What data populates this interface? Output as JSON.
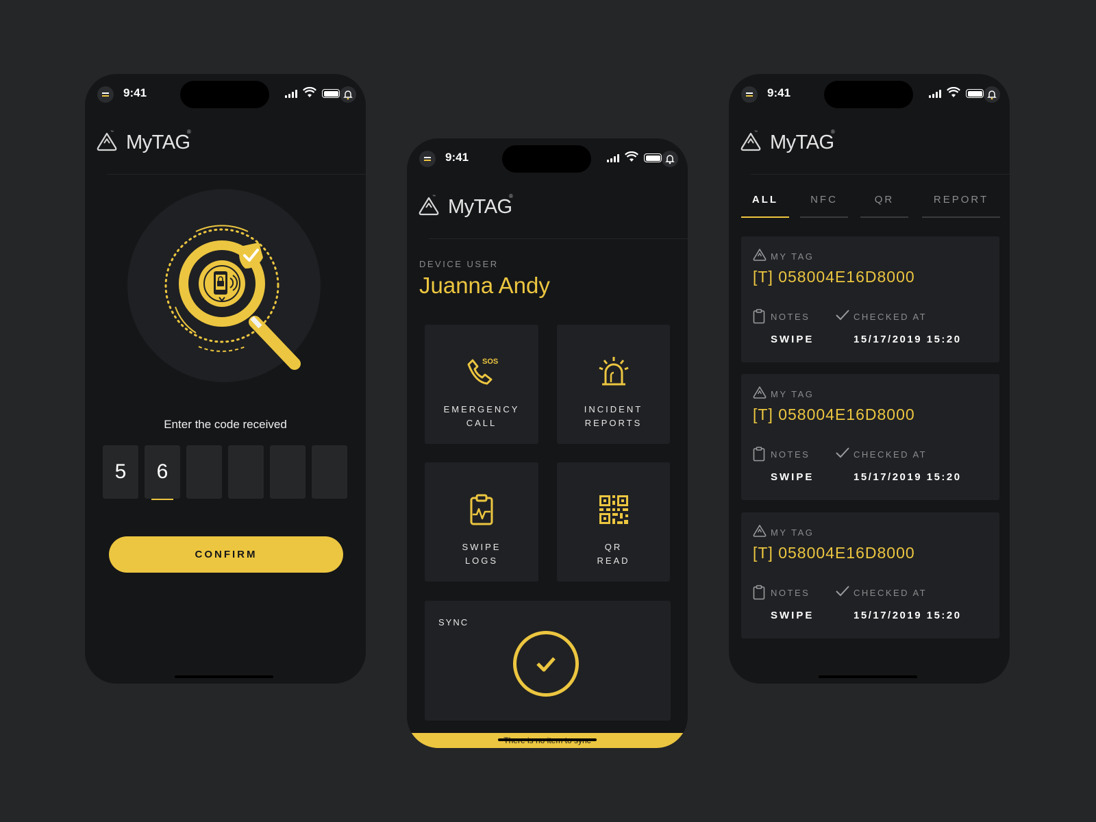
{
  "theme": {
    "background": "#252628",
    "phone": "#151618",
    "card": "#202124",
    "accent": "#ecc640"
  },
  "status": {
    "time": "9:41"
  },
  "brand": {
    "name": "MyTAG",
    "reg": "®",
    "tm": "™"
  },
  "verify": {
    "prompt": "Enter the code received",
    "code": [
      "5",
      "6",
      "",
      "",
      "",
      ""
    ],
    "active_index": 1,
    "confirm_label": "CONFIRM",
    "hero_icon": "magnifier-phone-lock-icon"
  },
  "home": {
    "device_label": "DEVICE USER",
    "device_name": "Juanna Andy",
    "tiles": [
      {
        "label": "EMERGENCY\nCALL",
        "icon": "sos-phone-icon"
      },
      {
        "label": "INCIDENT\nREPORTS",
        "icon": "siren-icon"
      },
      {
        "label": "SWIPE\nLOGS",
        "icon": "clipboard-pulse-icon"
      },
      {
        "label": "QR\nREAD",
        "icon": "qr-code-icon"
      }
    ],
    "sync_label": "SYNC",
    "sync_message": "There is no item to sync"
  },
  "logs": {
    "tabs": [
      "ALL",
      "NFC",
      "QR",
      "REPORT"
    ],
    "active_tab": 0,
    "entries": [
      {
        "tag_label": "MY TAG",
        "tag_id": "[T] 058004E16D8000",
        "notes_label": "NOTES",
        "notes_value": "SWIPE",
        "checked_label": "CHECKED AT",
        "checked_value": "15/17/2019   15:20"
      },
      {
        "tag_label": "MY TAG",
        "tag_id": "[T] 058004E16D8000",
        "notes_label": "NOTES",
        "notes_value": "SWIPE",
        "checked_label": "CHECKED AT",
        "checked_value": "15/17/2019   15:20"
      },
      {
        "tag_label": "MY TAG",
        "tag_id": "[T] 058004E16D8000",
        "notes_label": "NOTES",
        "notes_value": "SWIPE",
        "checked_label": "CHECKED AT",
        "checked_value": "15/17/2019   15:20"
      }
    ]
  }
}
